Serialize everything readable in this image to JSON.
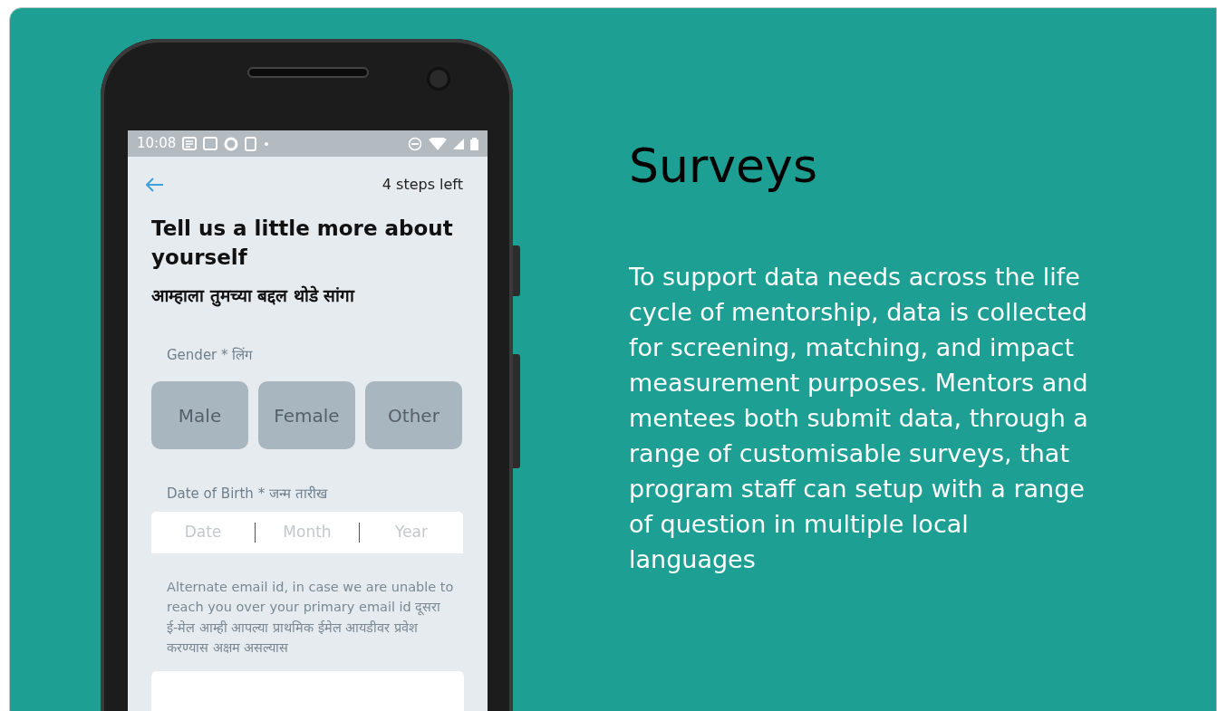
{
  "phone": {
    "status_bar": {
      "time": "10:08"
    },
    "header": {
      "steps": "4 steps left"
    },
    "title": "Tell us a little more about yourself",
    "subtitle": "आम्हाला तुमच्या बद्दल थोडे सांगा",
    "gender": {
      "label": "Gender * लिंग",
      "options": [
        {
          "label": "Male",
          "selected": false
        },
        {
          "label": "Female",
          "selected": false
        },
        {
          "label": "Other",
          "selected": false
        }
      ]
    },
    "dob": {
      "label": "Date of Birth * जन्म तारीख",
      "fields": [
        {
          "placeholder": "Date"
        },
        {
          "placeholder": "Month"
        },
        {
          "placeholder": "Year"
        }
      ]
    },
    "email": {
      "label": "Alternate email id, in case we are unable to reach you over your primary email id  दूसरा ई-मेल आम्ही आपल्या प्राथमिक ईमेल आयडीवर प्रवेश करण्यास अक्षम असल्यास"
    }
  },
  "heading": "Surveys",
  "description": "To support data needs across the life cycle of mentorship, data is collected for screening, matching, and impact measurement purposes. Mentors and mentees both submit data, through a range of customisable surveys, that program staff can setup with a range of question in multiple local languages"
}
